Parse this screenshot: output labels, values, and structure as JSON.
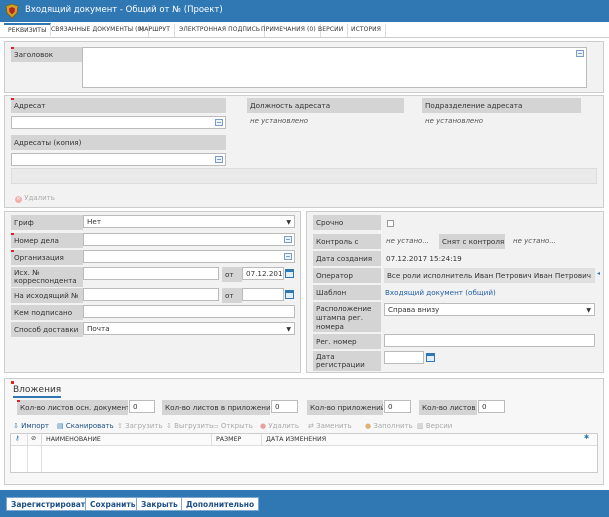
{
  "window": {
    "title": "Входящий документ - Общий от № (Проект)"
  },
  "tabs": [
    {
      "label": "РЕКВИЗИТЫ",
      "active": true
    },
    {
      "label": "СВЯЗАННЫЕ ДОКУМЕНТЫ (0)"
    },
    {
      "label": "МАРШРУТ"
    },
    {
      "label": "ЭЛЕКТРОННАЯ ПОДПИСЬ"
    },
    {
      "label": "ПРИМЕЧАНИЯ (0)"
    },
    {
      "label": "ВЕРСИИ"
    },
    {
      "label": "ИСТОРИЯ"
    }
  ],
  "header": {
    "zagolovok_label": "Заголовок"
  },
  "addressee": {
    "adresat_label": "Адресат",
    "position_label": "Должность адресата",
    "position_value": "не установлено",
    "department_label": "Подразделение адресата",
    "department_value": "не установлено",
    "copies_label": "Адресаты (копия)",
    "delete_label": "Удалить"
  },
  "left_form": {
    "grif_label": "Гриф",
    "grif_value": "Нет",
    "case_label": "Номер дела",
    "org_label": "Организация",
    "ref_label": "Исх. № корреспондента",
    "ref_from_label": "от",
    "ref_date": "07.12.2017",
    "outgoing_label": "На исходящий №",
    "outgoing_from_label": "от",
    "signed_label": "Кем подписано",
    "delivery_label": "Способ доставки",
    "delivery_value": "Почта"
  },
  "right_form": {
    "urgent_label": "Срочно",
    "control_label": "Контроль с",
    "control_value": "не устано...",
    "removed_label": "Снят с контроля",
    "removed_value": "не устано...",
    "created_label": "Дата создания",
    "created_value": "07.12.2017 15:24:19",
    "operator_label": "Оператор",
    "operator_value": "Все роли исполнитель Иван Петрович Иван Петрович",
    "template_label": "Шаблон",
    "template_value": "Входящий документ (общий)",
    "stamp_label": "Расположение штампа рег. номера",
    "stamp_value": "Справа внизу",
    "regnum_label": "Рег. номер",
    "regdate_label": "Дата регистрации"
  },
  "attachments": {
    "title": "Вложения",
    "main_sheets_label": "Кол-во листов осн. документа",
    "main_sheets_value": "0",
    "app_sheets_label": "Кол-во листов в приложении",
    "app_sheets_value": "0",
    "apps_label": "Кол-во приложений",
    "apps_value": "0",
    "sheets_label": "Кол-во листов",
    "sheets_value": "0",
    "toolbar": {
      "import": "Импорт",
      "scan": "Сканировать",
      "upload": "Загрузить",
      "download": "Выгрузить",
      "open": "Открыть",
      "delete": "Удалить",
      "replace": "Заменить",
      "fill": "Заполнить",
      "versions": "Версии"
    },
    "columns": {
      "name": "НАИМЕНОВАНИЕ",
      "size": "РАЗМЕР",
      "modified": "ДАТА ИЗМЕНЕНИЯ"
    }
  },
  "footer": {
    "register": "Зарегистрировать",
    "save": "Сохранить",
    "close": "Закрыть",
    "more": "Дополнительно"
  },
  "colors": {
    "accent": "#2f78b4",
    "label_bg": "#d4d4d4",
    "required": "#dd2222",
    "link": "#1f5fa8"
  }
}
